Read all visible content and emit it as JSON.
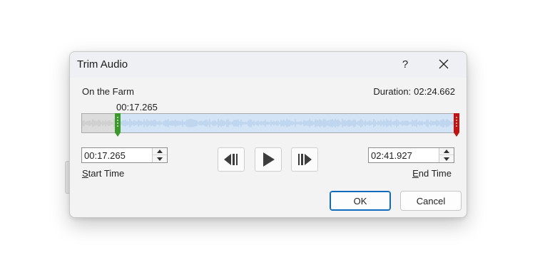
{
  "dialog": {
    "title": "Trim Audio",
    "help_label": "?",
    "clip_name": "On the Farm",
    "duration_label": "Duration:",
    "duration_value": "02:24.662",
    "start_marker_time": "00:17.265",
    "start_time": {
      "value": "00:17.265",
      "label_accel": "S",
      "label_rest": "tart Time"
    },
    "end_time": {
      "value": "02:41.927",
      "label_accel": "E",
      "label_rest": "nd Time"
    },
    "ok_label": "OK",
    "cancel_label": "Cancel"
  },
  "timeline": {
    "start_handle_color": "#3a9a27",
    "end_handle_color": "#c21313",
    "selected_color": "#d2e4f6",
    "trimmed_color": "#dcdcdc"
  },
  "icons": {
    "previous_frame": "previous-frame-icon",
    "play": "play-icon",
    "next_frame": "next-frame-icon",
    "close": "close-icon",
    "spin_up": "chevron-up-icon",
    "spin_down": "chevron-down-icon"
  }
}
